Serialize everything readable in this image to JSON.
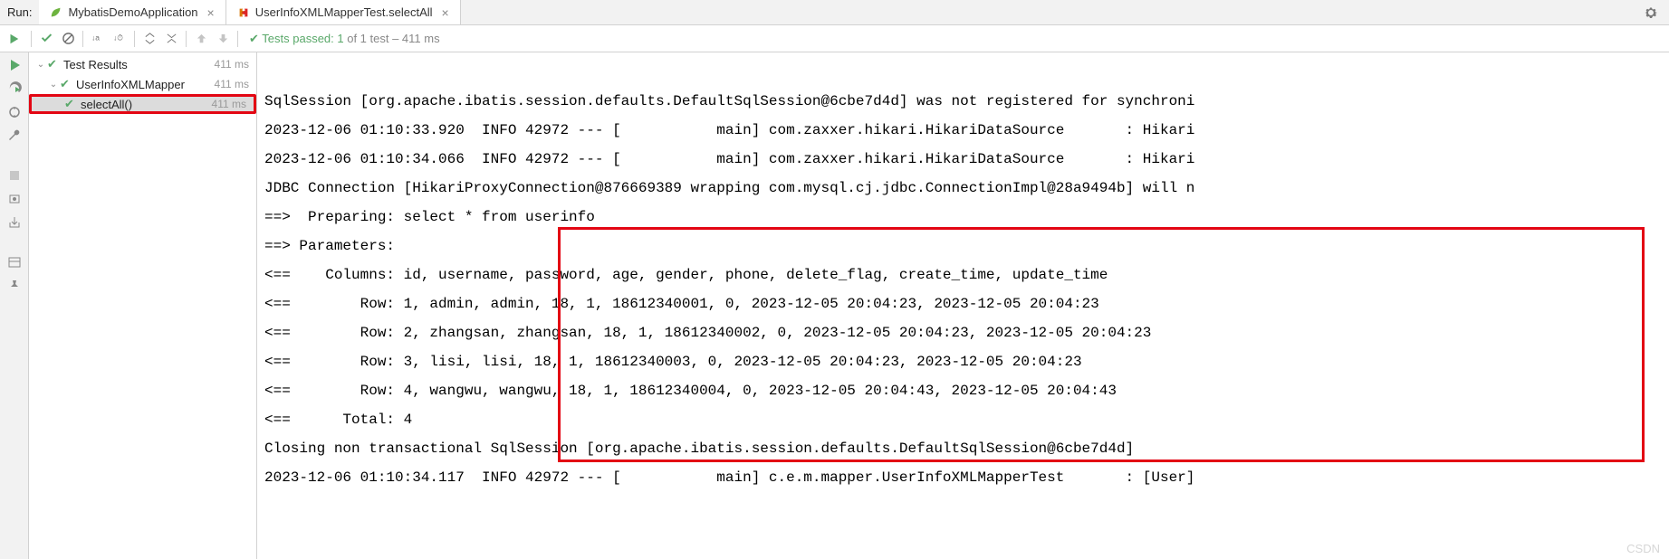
{
  "topbar": {
    "run_label": "Run:",
    "tabs": [
      {
        "label": "MybatisDemoApplication"
      },
      {
        "label": "UserInfoXMLMapperTest.selectAll"
      }
    ]
  },
  "toolbar": {
    "status_prefix": "✔ ",
    "status_passed": "Tests passed: 1",
    "status_dim": " of 1 test – 411 ms"
  },
  "tree": {
    "root": {
      "label": "Test Results",
      "time": "411 ms"
    },
    "node1": {
      "label": "UserInfoXMLMapper",
      "time": "411 ms"
    },
    "node2": {
      "label": "selectAll()",
      "time": "411 ms"
    }
  },
  "console_lines": {
    "l1": "SqlSession [org.apache.ibatis.session.defaults.DefaultSqlSession@6cbe7d4d] was not registered for synchroni",
    "l2": "2023-12-06 01:10:33.920  INFO 42972 --- [           main] com.zaxxer.hikari.HikariDataSource       : Hikari",
    "l3": "2023-12-06 01:10:34.066  INFO 42972 --- [           main] com.zaxxer.hikari.HikariDataSource       : Hikari",
    "l4": "JDBC Connection [HikariProxyConnection@876669389 wrapping com.mysql.cj.jdbc.ConnectionImpl@28a9494b] will n",
    "l5": "==>  Preparing: select * from userinfo",
    "l6": "==> Parameters: ",
    "l7": "<==    Columns: id, username, password, age, gender, phone, delete_flag, create_time, update_time",
    "l8": "<==        Row: 1, admin, admin, 18, 1, 18612340001, 0, 2023-12-05 20:04:23, 2023-12-05 20:04:23",
    "l9": "<==        Row: 2, zhangsan, zhangsan, 18, 1, 18612340002, 0, 2023-12-05 20:04:23, 2023-12-05 20:04:23",
    "l10": "<==        Row: 3, lisi, lisi, 18, 1, 18612340003, 0, 2023-12-05 20:04:23, 2023-12-05 20:04:23",
    "l11": "<==        Row: 4, wangwu, wangwu, 18, 1, 18612340004, 0, 2023-12-05 20:04:43, 2023-12-05 20:04:43",
    "l12": "<==      Total: 4",
    "l13": "Closing non transactional SqlSession [org.apache.ibatis.session.defaults.DefaultSqlSession@6cbe7d4d]",
    "l14": "2023-12-06 01:10:34.117  INFO 42972 --- [           main] c.e.m.mapper.UserInfoXMLMapperTest       : [User]"
  },
  "watermark": "CSDN"
}
